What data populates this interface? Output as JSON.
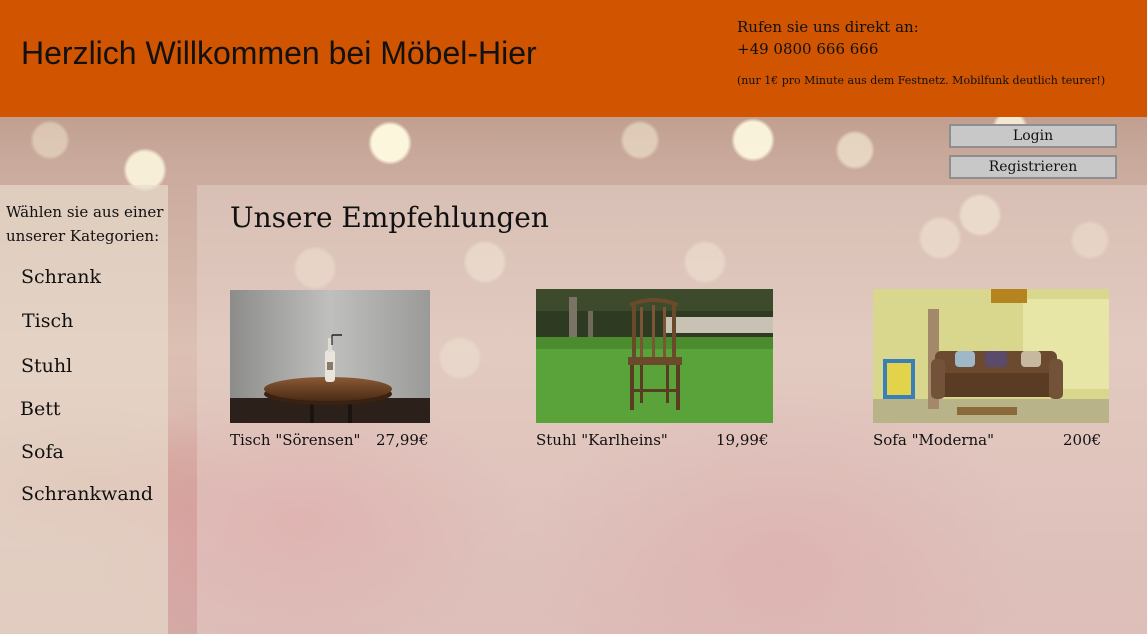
{
  "header": {
    "title": "Herzlich Willkommen bei Möbel-Hier",
    "contact_label": "Rufen sie uns direkt an:",
    "phone": "+49 0800 666 666",
    "note": "(nur 1€ pro Minute aus dem Festnetz. Mobilfunk deutlich teurer!)"
  },
  "auth": {
    "login_label": "Login",
    "register_label": "Registrieren"
  },
  "sidebar": {
    "intro": "Wählen sie aus einer unserer Kategorien:",
    "categories": [
      {
        "label": "Schrank"
      },
      {
        "label": "Tisch"
      },
      {
        "label": "Stuhl"
      },
      {
        "label": "Bett"
      },
      {
        "label": "Sofa"
      },
      {
        "label": "Schrankwand"
      }
    ]
  },
  "main": {
    "title": "Unsere Empfehlungen",
    "products": [
      {
        "name": "Tisch \"Sörensen\"",
        "price": "27,99€",
        "image": "round-table-with-bottle"
      },
      {
        "name": "Stuhl \"Karlheins\"",
        "price": "19,99€",
        "image": "wooden-chair-on-lawn"
      },
      {
        "name": "Sofa \"Moderna\"",
        "price": "200€",
        "image": "brown-sofa-living-room"
      }
    ]
  },
  "colors": {
    "header_bg": "#d15400",
    "button_bg": "#c8c8c8"
  }
}
